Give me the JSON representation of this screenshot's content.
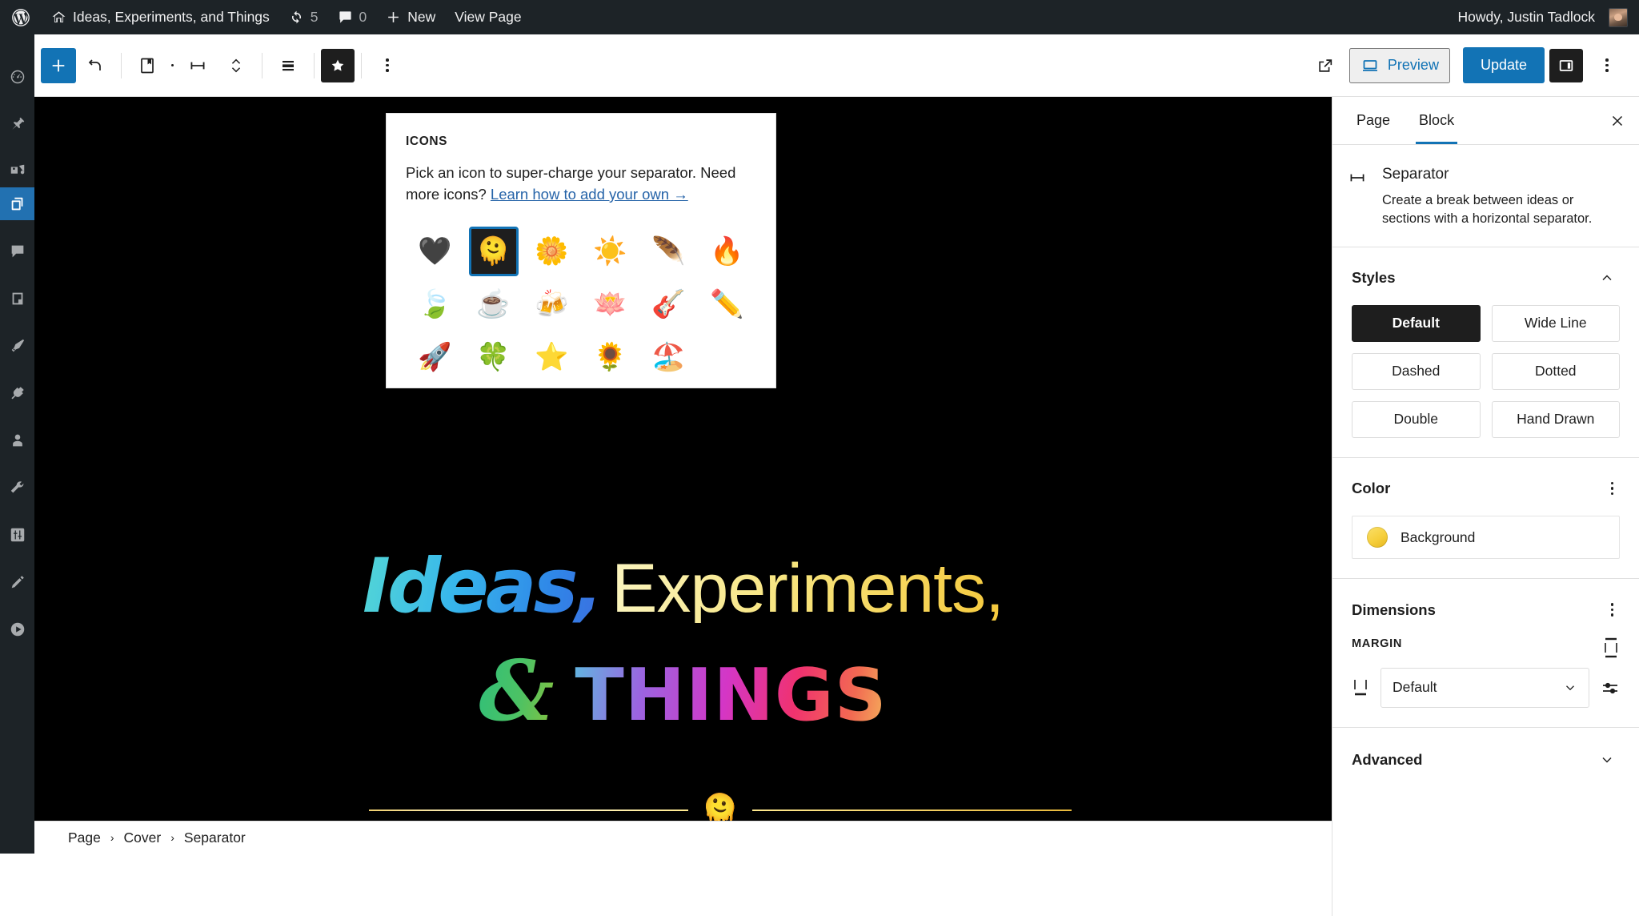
{
  "admin_bar": {
    "logo_icon": "wordpress-logo-icon",
    "site_home_icon": "home-icon",
    "site_name": "Ideas, Experiments, and Things",
    "updates_icon": "updates-icon",
    "updates_count": "5",
    "comments_icon": "comment-bubble-icon",
    "comments_count": "0",
    "new_icon": "plus-icon",
    "new_label": "New",
    "view_page_label": "View Page",
    "howdy_label": "Howdy, Justin Tadlock",
    "avatar_icon": "user-avatar"
  },
  "admin_menu": {
    "items": [
      {
        "name": "dashboard",
        "icon": "dashboard-icon",
        "active": false
      },
      {
        "name": "posts",
        "icon": "pin-icon",
        "active": false
      },
      {
        "name": "media",
        "icon": "media-icon",
        "active": false
      },
      {
        "name": "pages",
        "icon": "pages-icon",
        "active": true
      },
      {
        "name": "comments",
        "icon": "comment-bubble-icon",
        "active": false
      },
      {
        "name": "templates",
        "icon": "book-icon",
        "active": false
      },
      {
        "name": "appearance",
        "icon": "paintbrush-icon",
        "active": false
      },
      {
        "name": "plugins",
        "icon": "plug-icon",
        "active": false
      },
      {
        "name": "users",
        "icon": "user-icon",
        "active": false
      },
      {
        "name": "tools",
        "icon": "wrench-icon",
        "active": false
      },
      {
        "name": "settings",
        "icon": "sliders-icon",
        "active": false
      },
      {
        "name": "editor",
        "icon": "pencil-icon",
        "active": false
      },
      {
        "name": "player",
        "icon": "play-circle-icon",
        "active": false
      }
    ]
  },
  "editor_toolbar": {
    "add_block_icon": "plus-icon",
    "undo_icon": "undo-arrow-icon",
    "document_overview_icon": "document-bookmark-icon",
    "block_type_icon": "separator-icon",
    "move_icon": "chevron-up-down-icon",
    "align_icon": "align-lines-icon",
    "star_icon": "star-icon",
    "options_icon": "kebab-menu-icon",
    "external_link_icon": "external-link-icon",
    "preview_icon": "laptop-icon",
    "preview_label": "Preview",
    "update_label": "Update",
    "settings_sidebar_icon": "sidebar-panel-icon",
    "more_icon": "kebab-menu-icon",
    "accent_color": "#1273b5"
  },
  "icons_popover": {
    "section_label": "ICONS",
    "help_text_before": "Pick an icon to super-charge your separator. Need more icons?",
    "help_link": "Learn how to add your own →",
    "icons": [
      {
        "name": "black-heart-icon",
        "glyph": "🖤",
        "selected": false
      },
      {
        "name": "melting-face-icon",
        "glyph": "🫠",
        "selected": true
      },
      {
        "name": "blossom-icon",
        "glyph": "🌼",
        "selected": false
      },
      {
        "name": "sun-icon",
        "glyph": "☀️",
        "selected": false
      },
      {
        "name": "feather-icon",
        "glyph": "🪶",
        "selected": false
      },
      {
        "name": "fire-icon",
        "glyph": "🔥",
        "selected": false
      },
      {
        "name": "leaf-fluttering-icon",
        "glyph": "🍃",
        "selected": false
      },
      {
        "name": "coffee-icon",
        "glyph": "☕",
        "selected": false
      },
      {
        "name": "beer-mugs-icon",
        "glyph": "🍻",
        "selected": false
      },
      {
        "name": "lotus-icon",
        "glyph": "🪷",
        "selected": false
      },
      {
        "name": "guitar-icon",
        "glyph": "🎸",
        "selected": false
      },
      {
        "name": "pencil-icon",
        "glyph": "✏️",
        "selected": false
      },
      {
        "name": "rocket-icon",
        "glyph": "🚀",
        "selected": false
      },
      {
        "name": "four-leaf-clover-icon",
        "glyph": "🍀",
        "selected": false
      },
      {
        "name": "star-icon",
        "glyph": "⭐",
        "selected": false
      },
      {
        "name": "sunflower-icon",
        "glyph": "🌻",
        "selected": false
      },
      {
        "name": "beach-umbrella-icon",
        "glyph": "🏖️",
        "selected": false
      }
    ]
  },
  "canvas": {
    "background_color": "#000000",
    "title_line1_part1": "Ideas,",
    "title_line1_part2": "Experiments,",
    "title_line2_part1": "&",
    "title_line2_part2": "THINGS",
    "separator_emoji": "🫠",
    "separator_color": "#f2cf5e"
  },
  "block_sidebar": {
    "tab_page": "Page",
    "tab_block": "Block",
    "active_tab": "Block",
    "close_icon": "close-icon",
    "block_icon": "separator-icon",
    "block_title": "Separator",
    "block_description": "Create a break between ideas or sections with a horizontal separator.",
    "styles": {
      "title": "Styles",
      "collapse_icon": "chevron-up-icon",
      "options": [
        {
          "label": "Default",
          "selected": true
        },
        {
          "label": "Wide Line",
          "selected": false
        },
        {
          "label": "Dashed",
          "selected": false
        },
        {
          "label": "Dotted",
          "selected": false
        },
        {
          "label": "Double",
          "selected": false
        },
        {
          "label": "Hand Drawn",
          "selected": false
        }
      ]
    },
    "color": {
      "title": "Color",
      "options_icon": "kebab-menu-icon",
      "background_label": "Background",
      "background_swatch_color": "#f3ce45"
    },
    "dimensions": {
      "title": "Dimensions",
      "options_icon": "kebab-menu-icon",
      "margin_label": "MARGIN",
      "margin_value": "Default",
      "margin_top_icon": "margin-top-icon",
      "margin_bottom_icon": "margin-bottom-icon",
      "custom_icon": "sliders-icon",
      "chevron_icon": "chevron-down-icon"
    },
    "advanced": {
      "title": "Advanced",
      "expand_icon": "chevron-down-icon"
    }
  },
  "breadcrumb": {
    "items": [
      "Page",
      "Cover",
      "Separator"
    ],
    "separator": "›"
  }
}
